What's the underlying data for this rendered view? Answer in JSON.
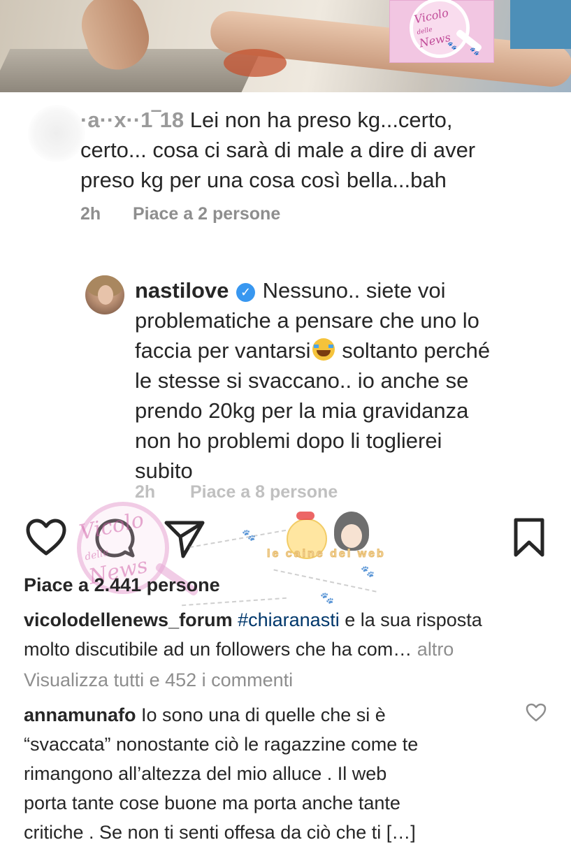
{
  "photo": {
    "watermark_text_line1": "Vicolo",
    "watermark_text_line2": "delle",
    "watermark_text_line3": "News"
  },
  "comment1": {
    "username": "·a··x··1‾18",
    "text": "Lei non ha preso kg...certo, certo... cosa ci sarà di male a dire di aver preso kg per una cosa così bella...bah",
    "line1": "Lei non ha preso kg...certo,",
    "line2": "certo... cosa ci sarà di male a dire di aver",
    "line3": "preso kg per una cosa così bella...bah",
    "time": "2h",
    "likes": "Piace a 2 persone"
  },
  "reply": {
    "username": "nastilove",
    "verified_icon": "verified-badge-icon",
    "line1": "Nessuno.. siete voi",
    "line2": "problematiche a pensare che uno lo",
    "line3a": "faccia per vantarsi",
    "emoji": "face-with-tears-of-joy",
    "line3b": "soltanto perché",
    "line4": "le stesse si svaccano.. io anche se",
    "line5": "prendo 20kg per la mia gravidanza",
    "line6": "non ho problemi dopo li toglierei",
    "line7": "subito",
    "time": "2h",
    "likes": "Piace a 8 persone"
  },
  "actions": {
    "icons": [
      "heart-icon",
      "comment-icon",
      "share-icon",
      "bookmark-icon"
    ]
  },
  "overlay": {
    "tagline": "le caine del web"
  },
  "post": {
    "likes": "Piace a 2.441 persone",
    "caption_user": "vicolodellenews_forum",
    "caption_hashtag": "#chiaranasti",
    "caption_line1_rest": "e la sua risposta",
    "caption_line2": "molto discutibile ad un followers che ha com…",
    "caption_more": "altro",
    "view_all": "Visualizza tutti e 452 i commenti"
  },
  "comment2": {
    "username": "annamunafo",
    "line1": "Io sono una di quelle che si è",
    "line2": "“svaccata” nonostante ciò le ragazzine come te",
    "line3": "rimangono all’altezza del mio alluce . Il web",
    "line4": "porta tante cose buone ma porta anche tante",
    "line5": "critiche . Se non ti senti offesa da ciò che ti […]"
  },
  "colors": {
    "text": "#262626",
    "muted": "#8e8e8e",
    "hashtag": "#00376b",
    "verified": "#3897f0",
    "watermark_pink": "#f2c6e2"
  }
}
